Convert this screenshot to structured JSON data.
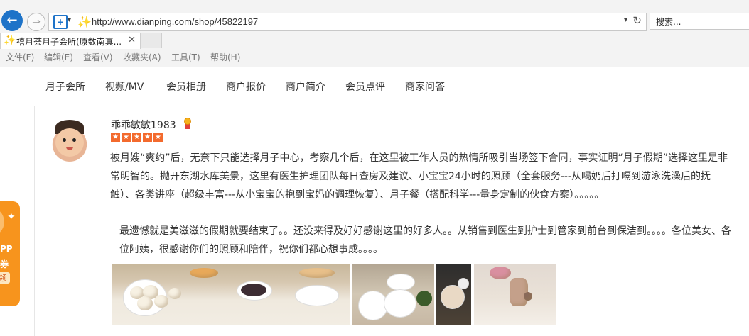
{
  "browser": {
    "url": "http://www.dianping.com/shop/45822197",
    "search_placeholder": "搜索...",
    "tab_title": "禧月荟月子会所(原数南真...",
    "menu": [
      "文件(F)",
      "编辑(E)",
      "查看(V)",
      "收藏夹(A)",
      "工具(T)",
      "帮助(H)"
    ]
  },
  "promo": {
    "line1": "PP",
    "line2": "券",
    "line3": "领"
  },
  "page_nav": [
    "月子会所",
    "视频/MV",
    "会员相册",
    "商户报价",
    "商户简介",
    "会员点评",
    "商家问答"
  ],
  "review": {
    "username": "乖乖敏敏1983",
    "rating": 5,
    "paragraph1": "被月嫂“爽约”后，无奈下只能选择月子中心，考察几个后，在这里被工作人员的热情所吸引当场签下合同，事实证明“月子假期”选择这里是非常明智的。抛开东湖水库美景，这里有医生护理团队每日查房及建议、小宝宝24小时的照顾（全套服务---从喝奶后打嗝到游泳洗澡后的抚触）、各类讲座（超级丰富---从小宝宝的抱到宝妈的调理恢复）、月子餐（搭配科学---量身定制的伙食方案）。。。。。",
    "paragraph2": "最遗憾就是美滋滋的假期就要结束了。。还没来得及好好感谢这里的好多人。。从销售到医生到护士到管家到前台到保洁到。。。。各位美女、各位阿姨，很感谢你们的照顾和陪伴，祝你们都心想事成。。。。"
  },
  "colors": {
    "accent": "#f36a2d",
    "link_blue": "#1e73c8",
    "promo": "#f7941d"
  }
}
